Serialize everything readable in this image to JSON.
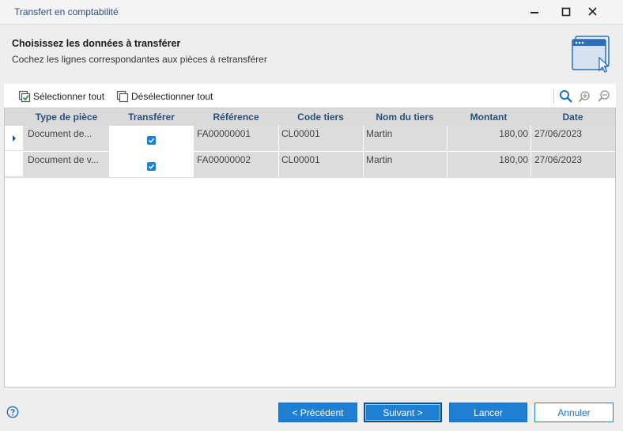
{
  "window": {
    "title": "Transfert en comptabilité",
    "controls": [
      "minimize-icon",
      "maximize-icon",
      "close-icon"
    ]
  },
  "header": {
    "title": "Choisissez les données à transférer",
    "subtitle": "Cochez les lignes correspondantes aux pièces à retransférer",
    "illustration": "window-cursor-icon"
  },
  "toolbar": {
    "select_all": "Sélectionner tout",
    "deselect_all": "Désélectionner tout",
    "icons": [
      "search-icon",
      "zoom-in-icon",
      "zoom-out-icon"
    ]
  },
  "grid": {
    "columns": [
      "Type de pièce",
      "Transférer",
      "Référence",
      "Code tiers",
      "Nom du tiers",
      "Montant",
      "Date"
    ],
    "rows": [
      {
        "type": "Document de...",
        "transferer": true,
        "reference": "FA00000001",
        "code_tiers": "CL00001",
        "nom_tiers": "Martin",
        "montant": "180,00",
        "date": "27/06/2023",
        "current": true
      },
      {
        "type": "Document de v...",
        "transferer": true,
        "reference": "FA00000002",
        "code_tiers": "CL00001",
        "nom_tiers": "Martin",
        "montant": "180,00",
        "date": "27/06/2023",
        "current": false
      }
    ]
  },
  "footer": {
    "previous": "< Précédent",
    "next": "Suivant >",
    "launch": "Lancer",
    "cancel": "Annuler",
    "help_icon": "help-icon"
  },
  "colors": {
    "accent": "#1f7fd2",
    "header_text": "#2b4f7d",
    "row_bg": "#dcdcdc"
  }
}
